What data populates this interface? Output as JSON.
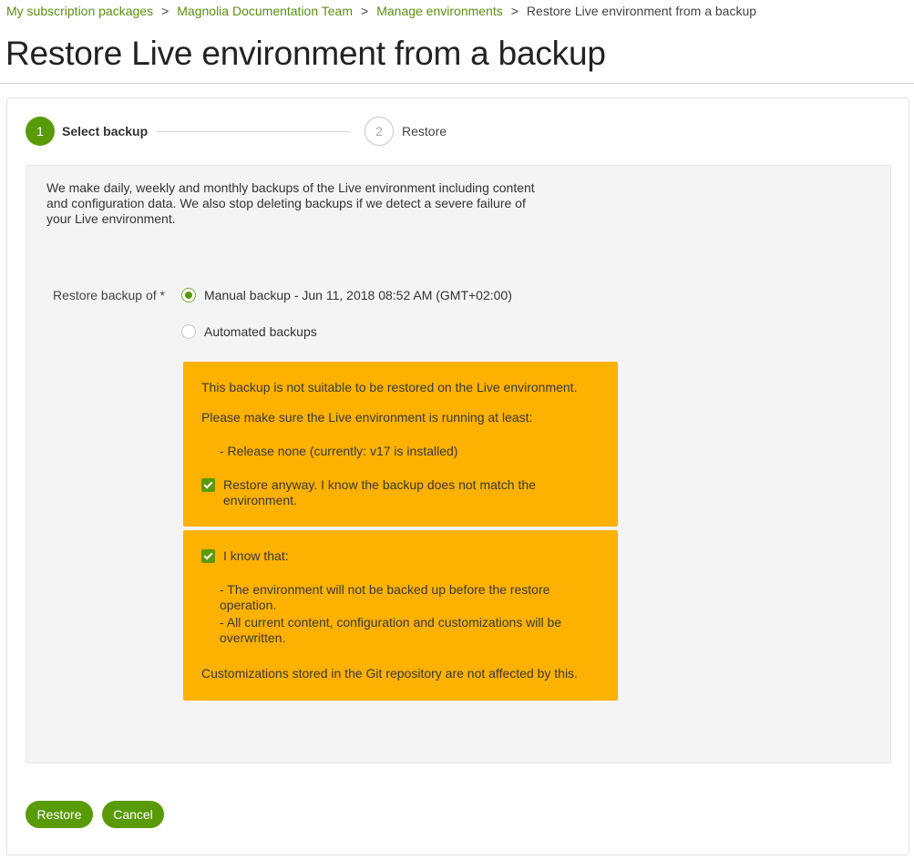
{
  "breadcrumb": {
    "items": [
      "My subscription packages",
      "Magnolia Documentation Team",
      "Manage environments"
    ],
    "separator": ">",
    "current": "Restore Live environment from a backup"
  },
  "page_title": "Restore Live environment from a backup",
  "stepper": {
    "steps": [
      {
        "number": "1",
        "label": "Select backup",
        "state": "active"
      },
      {
        "number": "2",
        "label": "Restore",
        "state": "inactive"
      }
    ]
  },
  "intro_text": "We make daily, weekly and monthly backups of the Live environment including content and configuration data. We also stop deleting backups if we detect a severe failure of your Live environment.",
  "restore_field": {
    "label": "Restore backup of *",
    "options": [
      {
        "label": "Manual backup - Jun 11, 2018 08:52 AM (GMT+02:00)",
        "selected": true
      },
      {
        "label": "Automated backups",
        "selected": false
      }
    ]
  },
  "warning_box": {
    "line1": "This backup is not suitable to be restored on the Live environment.",
    "line2": "Please make sure the Live environment is running at least:",
    "requirement": "-  Release none (currently: v17 is installed)",
    "checkbox_label": "Restore anyway. I know the backup does not match the environment.",
    "checkbox_checked": true
  },
  "acknowledge_box": {
    "checkbox_label": "I know that:",
    "checkbox_checked": true,
    "points": [
      "-  The environment will not be backed up before the restore operation.",
      "-  All current content, configuration and customizations will be overwritten."
    ],
    "footer": "Customizations stored in the Git repository are not affected by this."
  },
  "buttons": {
    "restore": "Restore",
    "cancel": "Cancel"
  },
  "colors": {
    "accent": "#599a08",
    "link": "#5a8f0f",
    "warning": "#fdb100"
  }
}
